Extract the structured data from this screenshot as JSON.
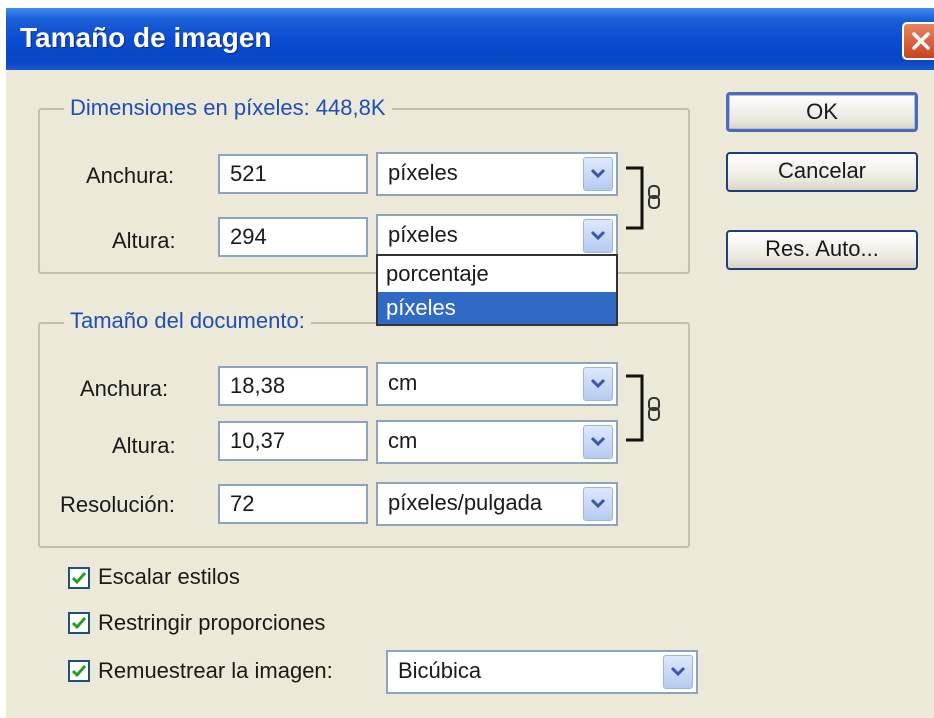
{
  "window": {
    "title": "Tamaño de imagen"
  },
  "pixel_dims": {
    "title": "Dimensiones en píxeles: 448,8K",
    "width": {
      "label": "Anchura:",
      "value": "521",
      "unit": "píxeles"
    },
    "height": {
      "label": "Altura:",
      "value": "294",
      "unit": "píxeles"
    }
  },
  "unit_dropdown": {
    "options": [
      "porcentaje",
      "píxeles"
    ],
    "selected": "píxeles"
  },
  "doc_size": {
    "title": "Tamaño del documento:",
    "width": {
      "label": "Anchura:",
      "value": "18,38",
      "unit": "cm"
    },
    "height": {
      "label": "Altura:",
      "value": "10,37",
      "unit": "cm"
    },
    "resolution": {
      "label": "Resolución:",
      "value": "72",
      "unit": "píxeles/pulgada"
    }
  },
  "options": {
    "scale_styles": {
      "label": "Escalar estilos",
      "checked": true
    },
    "constrain": {
      "label": "Restringir proporciones",
      "checked": true
    },
    "resample": {
      "label": "Remuestrear la imagen:",
      "checked": true,
      "method": "Bicúbica"
    }
  },
  "buttons": {
    "ok": "OK",
    "cancel": "Cancelar",
    "auto": "Res. Auto..."
  },
  "colors": {
    "titlebar": "#0a4bcf",
    "group_title": "#1f4fb5",
    "selection": "#316ac5",
    "dialog_bg": "#ece9d8"
  }
}
